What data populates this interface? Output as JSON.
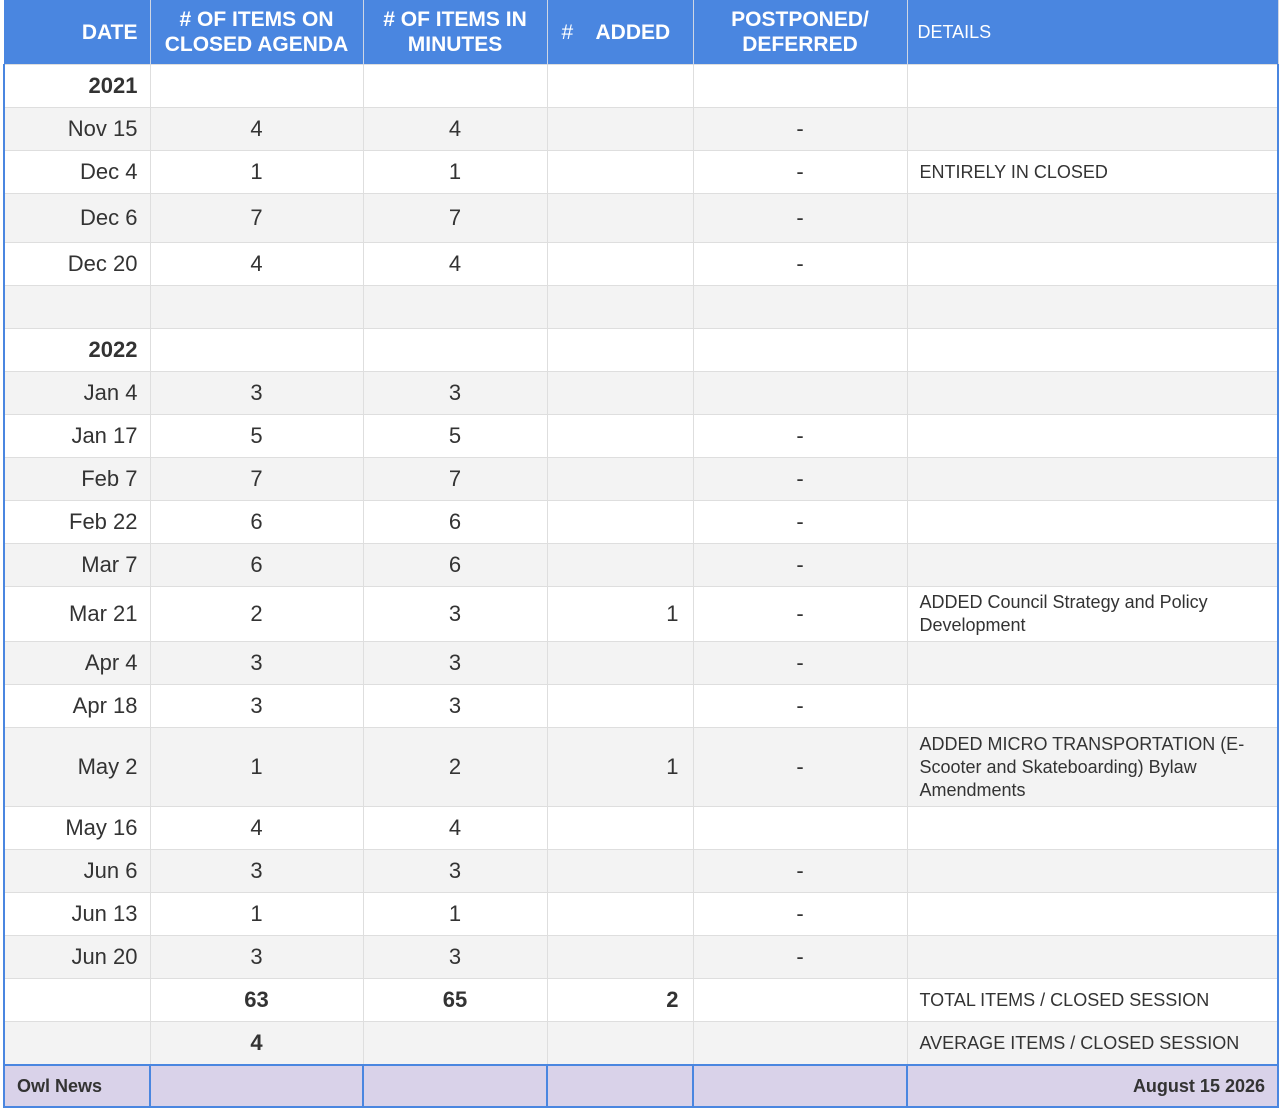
{
  "header": {
    "date": "DATE",
    "closed_agenda": "# OF ITEMS ON CLOSED AGENDA",
    "minutes": "# OF ITEMS IN MINUTES",
    "added_hash": "#",
    "added": "ADDED",
    "postponed": "POSTPONED/ DEFERRED",
    "details": "DETAILS"
  },
  "rows": [
    {
      "date": "2021",
      "agenda": "",
      "minutes": "",
      "added": "",
      "postponed": "",
      "details": ""
    },
    {
      "date": "Nov 15",
      "agenda": "4",
      "minutes": "4",
      "added": "",
      "postponed": "-",
      "details": ""
    },
    {
      "date": "Dec 4",
      "agenda": "1",
      "minutes": "1",
      "added": "",
      "postponed": "-",
      "details": "ENTIRELY IN CLOSED"
    },
    {
      "date": "Dec 6",
      "agenda": "7",
      "minutes": "7",
      "added": "",
      "postponed": "-",
      "details": ""
    },
    {
      "date": "Dec 20",
      "agenda": "4",
      "minutes": "4",
      "added": "",
      "postponed": "-",
      "details": ""
    },
    {
      "date": "",
      "agenda": "",
      "minutes": "",
      "added": "",
      "postponed": "",
      "details": ""
    },
    {
      "date": "2022",
      "agenda": "",
      "minutes": "",
      "added": "",
      "postponed": "",
      "details": ""
    },
    {
      "date": "Jan 4",
      "agenda": "3",
      "minutes": "3",
      "added": "",
      "postponed": "",
      "details": ""
    },
    {
      "date": "Jan 17",
      "agenda": "5",
      "minutes": "5",
      "added": "",
      "postponed": "-",
      "details": ""
    },
    {
      "date": "Feb 7",
      "agenda": "7",
      "minutes": "7",
      "added": "",
      "postponed": "-",
      "details": ""
    },
    {
      "date": "Feb 22",
      "agenda": "6",
      "minutes": "6",
      "added": "",
      "postponed": "-",
      "details": ""
    },
    {
      "date": "Mar 7",
      "agenda": "6",
      "minutes": "6",
      "added": "",
      "postponed": "-",
      "details": ""
    },
    {
      "date": "Mar 21",
      "agenda": "2",
      "minutes": "3",
      "added": "1",
      "postponed": "-",
      "details": "ADDED Council Strategy and Policy Development"
    },
    {
      "date": "Apr 4",
      "agenda": "3",
      "minutes": "3",
      "added": "",
      "postponed": "-",
      "details": ""
    },
    {
      "date": "Apr 18",
      "agenda": "3",
      "minutes": "3",
      "added": "",
      "postponed": "-",
      "details": ""
    },
    {
      "date": "May 2",
      "agenda": "1",
      "minutes": "2",
      "added": "1",
      "postponed": "-",
      "details": "ADDED MICRO TRANSPORTATION (E-Scooter and Skateboarding) Bylaw Amendments"
    },
    {
      "date": "May 16",
      "agenda": "4",
      "minutes": "4",
      "added": "",
      "postponed": "",
      "details": ""
    },
    {
      "date": "Jun 6",
      "agenda": "3",
      "minutes": "3",
      "added": "",
      "postponed": "-",
      "details": ""
    },
    {
      "date": "Jun 13",
      "agenda": "1",
      "minutes": "1",
      "added": "",
      "postponed": "-",
      "details": ""
    },
    {
      "date": "Jun 20",
      "agenda": "3",
      "minutes": "3",
      "added": "",
      "postponed": "-",
      "details": ""
    }
  ],
  "totals": {
    "agenda": "63",
    "minutes": "65",
    "added": "2",
    "label": "TOTAL ITEMS /  CLOSED SESSION"
  },
  "average": {
    "agenda": "4",
    "label": "AVERAGE ITEMS / CLOSED SESSION"
  },
  "footer": {
    "left": "Owl News",
    "right": "August 15 2026"
  },
  "colors": {
    "header_bg": "#4a86e0",
    "alt_row_bg": "#f3f3f3",
    "footer_bg": "#d9d2e9"
  }
}
